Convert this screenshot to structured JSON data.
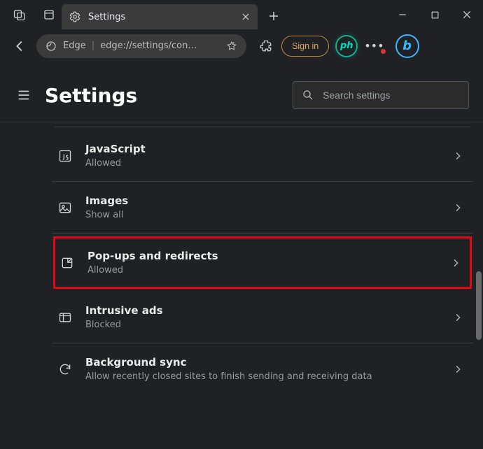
{
  "titlebar": {
    "tab_title": "Settings"
  },
  "toolbar": {
    "brand": "Edge",
    "url": "edge://settings/con…",
    "signin": "Sign in",
    "ph": "ph"
  },
  "header": {
    "title": "Settings",
    "search_placeholder": "Search settings"
  },
  "rows": [
    {
      "title": "JavaScript",
      "sub": "Allowed",
      "icon": "js-icon"
    },
    {
      "title": "Images",
      "sub": "Show all",
      "icon": "image-icon"
    },
    {
      "title": "Pop-ups and redirects",
      "sub": "Allowed",
      "icon": "popup-icon",
      "highlight": true
    },
    {
      "title": "Intrusive ads",
      "sub": "Blocked",
      "icon": "ads-icon"
    },
    {
      "title": "Background sync",
      "sub": "Allow recently closed sites to finish sending and receiving data",
      "icon": "sync-icon"
    }
  ]
}
